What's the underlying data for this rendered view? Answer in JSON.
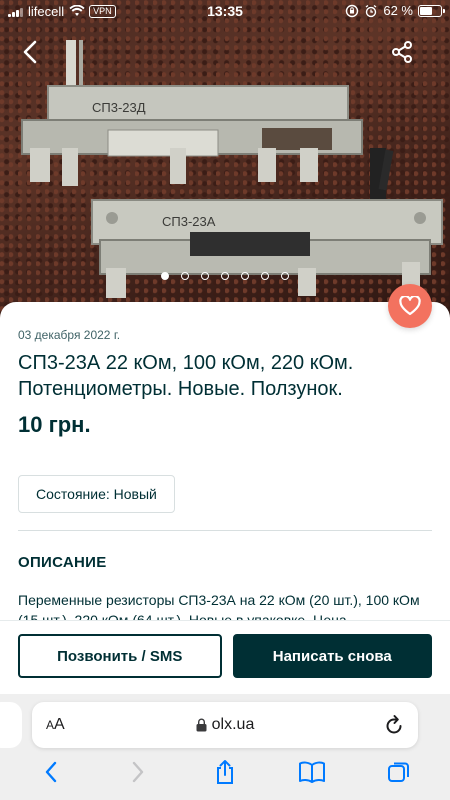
{
  "status_bar": {
    "carrier": "lifecell",
    "vpn": "VPN",
    "time": "13:35",
    "battery": "62 %",
    "battery_level": 0.62
  },
  "gallery": {
    "photo_count": 7,
    "active_index": 0,
    "photo_labels": [
      "СП3-23А",
      "СП3-23Д"
    ]
  },
  "listing": {
    "date": "03 декабря 2022 г.",
    "title": "СП3-23А 22 кОм, 100 кОм, 220 кОм. Потенциометры. Новые. Ползунок.",
    "price": "10 грн.",
    "condition": "Состояние: Новый",
    "description_heading": "ОПИСАНИЕ",
    "description": "Переменные резисторы СП3-23А на 22 кОм (20 шт.), 100 кОм (15 шт.), 220 кОм (64 шт.). Новые в упаковке. Цена"
  },
  "actions": {
    "call_label": "Позвонить / SMS",
    "message_label": "Написать снова"
  },
  "browser": {
    "text_size_label_small": "A",
    "text_size_label_large": "A",
    "url": "olx.ua"
  },
  "colors": {
    "brand_dark": "#002f34",
    "favorite": "#f3725f",
    "link_blue": "#007aff"
  },
  "icons": [
    "back-arrow-icon",
    "share-icon",
    "heart-icon",
    "lock-icon",
    "reload-icon",
    "chevron-left-icon",
    "chevron-right-icon",
    "share-up-icon",
    "book-icon",
    "tabs-icon"
  ]
}
